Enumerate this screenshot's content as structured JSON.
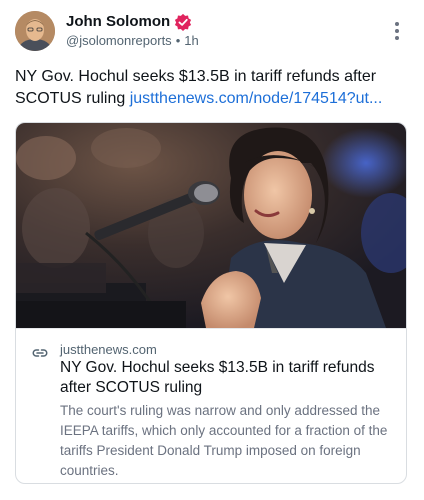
{
  "author": {
    "name": "John Solomon",
    "handle": "@jsolomonreports",
    "separator": "•",
    "time_ago": "1h",
    "verified_color": "#e0245e"
  },
  "post": {
    "text": "NY Gov. Hochul seeks $13.5B in tariff refunds after SCOTUS ruling ",
    "link_text": "justthenews.com/node/174514?ut..."
  },
  "link_card": {
    "domain": "justthenews.com",
    "title": "NY Gov. Hochul seeks $13.5B in tariff refunds after SCOTUS ruling",
    "description": "The court's ruling was narrow and only addressed the IEEPA tariffs, which only accounted for a fraction of the tariffs President Donald Trump imposed on foreign countries."
  },
  "icons": {
    "more": "more-vertical-icon",
    "link": "link-icon",
    "verified": "verified-badge-icon"
  },
  "colors": {
    "link": "#1d6fd8",
    "secondary_text": "#536471",
    "card_border": "#d9dde1"
  }
}
